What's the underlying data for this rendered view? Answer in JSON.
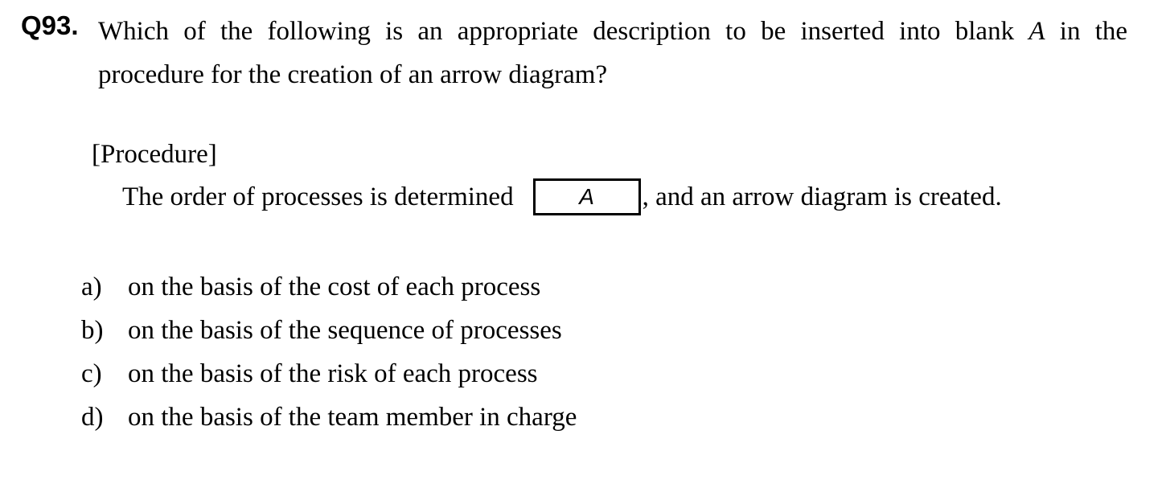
{
  "question": {
    "number": "Q93.",
    "stem_line1_before": "Which of the following is an appropriate description to be inserted into blank",
    "stem_blank_ref": "A",
    "stem_line1_after": "in the",
    "stem_line2": "procedure for the creation of an arrow diagram?"
  },
  "procedure": {
    "title": "[Procedure]",
    "text_before": "The order of processes is determined",
    "blank_label": "A",
    "text_after": ", and an arrow diagram is created."
  },
  "choices": [
    {
      "letter": "a)",
      "text": "on the basis of the cost of each process"
    },
    {
      "letter": "b)",
      "text": "on the basis of the sequence of processes"
    },
    {
      "letter": "c)",
      "text": "on the basis of the risk of each process"
    },
    {
      "letter": "d)",
      "text": "on the basis of the team member in charge"
    }
  ]
}
